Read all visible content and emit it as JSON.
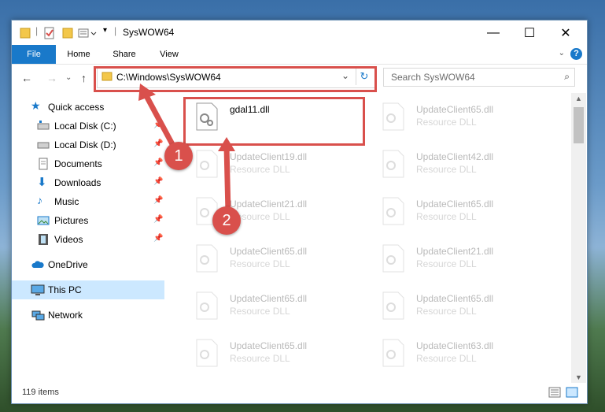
{
  "window": {
    "title": "SysWOW64"
  },
  "ribbon": {
    "tabs": [
      "File",
      "Home",
      "Share",
      "View"
    ]
  },
  "address": {
    "path": "C:\\Windows\\SysWOW64"
  },
  "search": {
    "placeholder": "Search SysWOW64"
  },
  "sidebar": {
    "items": [
      {
        "label": "Quick access"
      },
      {
        "label": "Local Disk (C:)"
      },
      {
        "label": "Local Disk (D:)"
      },
      {
        "label": "Documents"
      },
      {
        "label": "Downloads"
      },
      {
        "label": "Music"
      },
      {
        "label": "Pictures"
      },
      {
        "label": "Videos"
      },
      {
        "label": "OneDrive"
      },
      {
        "label": "This PC"
      },
      {
        "label": "Network"
      }
    ]
  },
  "files": [
    {
      "name": "gdal11.dll",
      "type": ""
    },
    {
      "name": "UpdateClient65.dll",
      "type": "Resource DLL"
    },
    {
      "name": "UpdateClient19.dll",
      "type": "Resource DLL"
    },
    {
      "name": "UpdateClient42.dll",
      "type": "Resource DLL"
    },
    {
      "name": "UpdateClient21.dll",
      "type": "Resource DLL"
    },
    {
      "name": "UpdateClient65.dll",
      "type": "Resource DLL"
    },
    {
      "name": "UpdateClient65.dll",
      "type": "Resource DLL"
    },
    {
      "name": "UpdateClient21.dll",
      "type": "Resource DLL"
    },
    {
      "name": "UpdateClient65.dll",
      "type": "Resource DLL"
    },
    {
      "name": "UpdateClient65.dll",
      "type": "Resource DLL"
    },
    {
      "name": "UpdateClient65.dll",
      "type": "Resource DLL"
    },
    {
      "name": "UpdateClient63.dll",
      "type": "Resource DLL"
    }
  ],
  "status": {
    "items": "119 items"
  },
  "markers": [
    "1",
    "2"
  ],
  "colors": {
    "accent": "#1979ca",
    "highlight": "#d9504c",
    "selected": "#cce8ff"
  }
}
